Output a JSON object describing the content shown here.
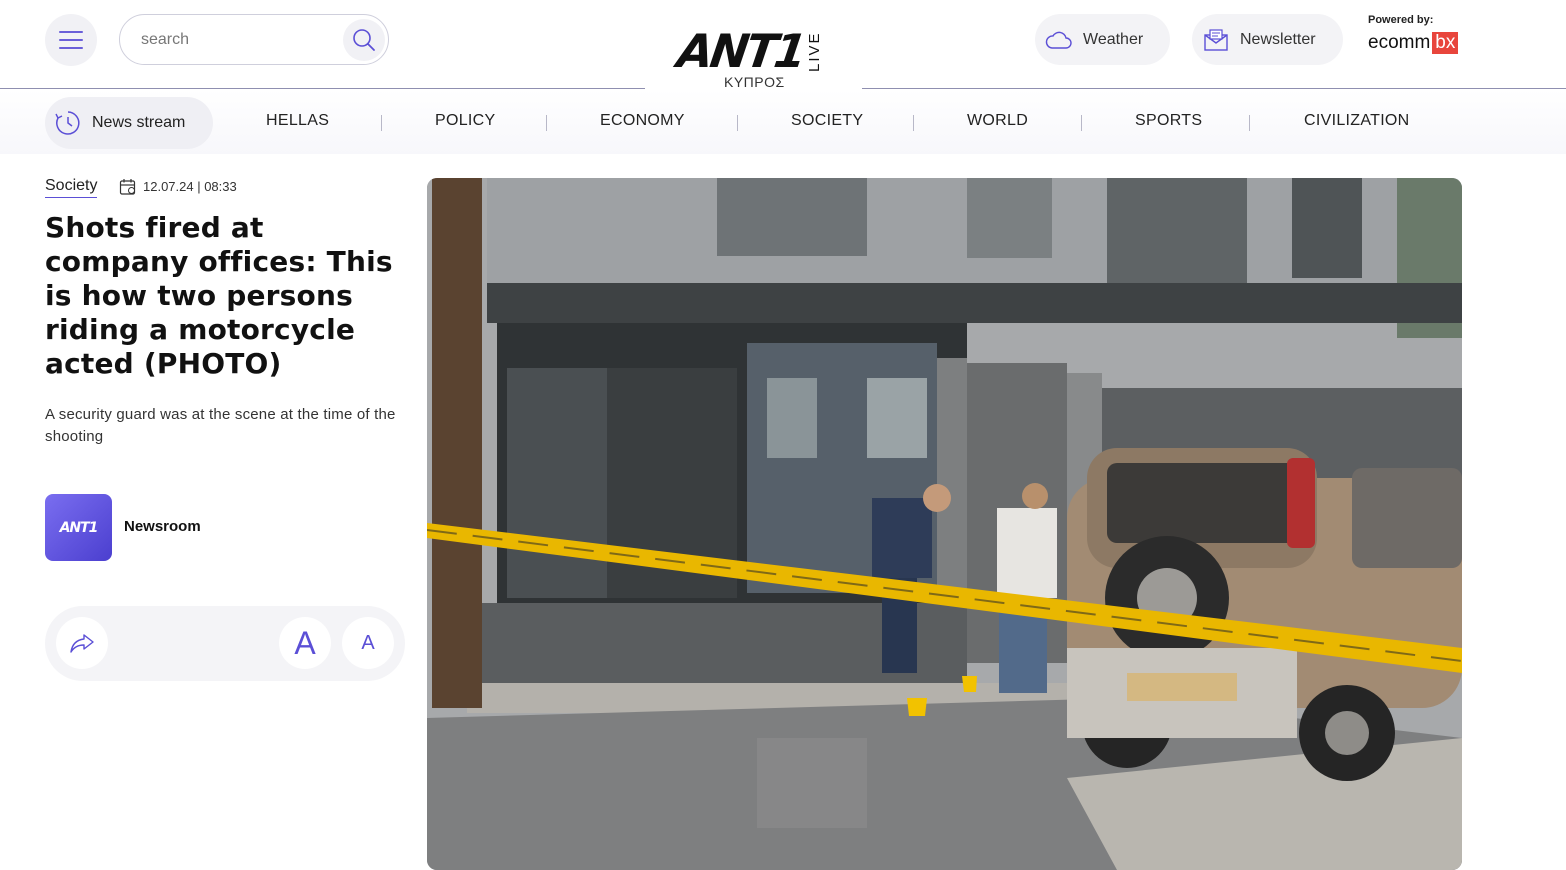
{
  "header": {
    "menu_icon": "hamburger-menu-icon",
    "search": {
      "placeholder": "search",
      "value": "",
      "icon": "search-icon"
    },
    "logo": {
      "main": "ANT1",
      "badge": "LIVE",
      "subtitle": "ΚΥΠΡΟΣ"
    },
    "weather": {
      "label": "Weather",
      "icon": "cloud-icon"
    },
    "newsletter": {
      "label": "Newsletter",
      "icon": "envelope-icon"
    },
    "powered": {
      "label": "Powered by:",
      "brand": "ecomm",
      "brand_suffix": "bx"
    }
  },
  "nav": {
    "news_stream": {
      "label": "News stream",
      "icon": "clock-icon"
    },
    "items": [
      "HELLAS",
      "POLICY",
      "ECONOMY",
      "SOCIETY",
      "WORLD",
      "SPORTS",
      "CIVILIZATION"
    ]
  },
  "article": {
    "category": "Society",
    "date": "12.07.24 | 08:33",
    "date_icon": "calendar-icon",
    "title": "Shots fired at company offices: This is how two persons riding a motorcycle acted (PHOTO)",
    "subtitle": "A security guard was at the scene at the time of the shooting",
    "author": {
      "name": "Newsroom",
      "avatar_text": "ANT1"
    },
    "tools": {
      "share_icon": "share-icon",
      "font_large": "A",
      "font_small": "A"
    }
  },
  "colors": {
    "accent": "#5b4fd6",
    "pill_bg": "#f3f3f6",
    "brand_red": "#e8453c",
    "police_tape": "#e9b700"
  }
}
